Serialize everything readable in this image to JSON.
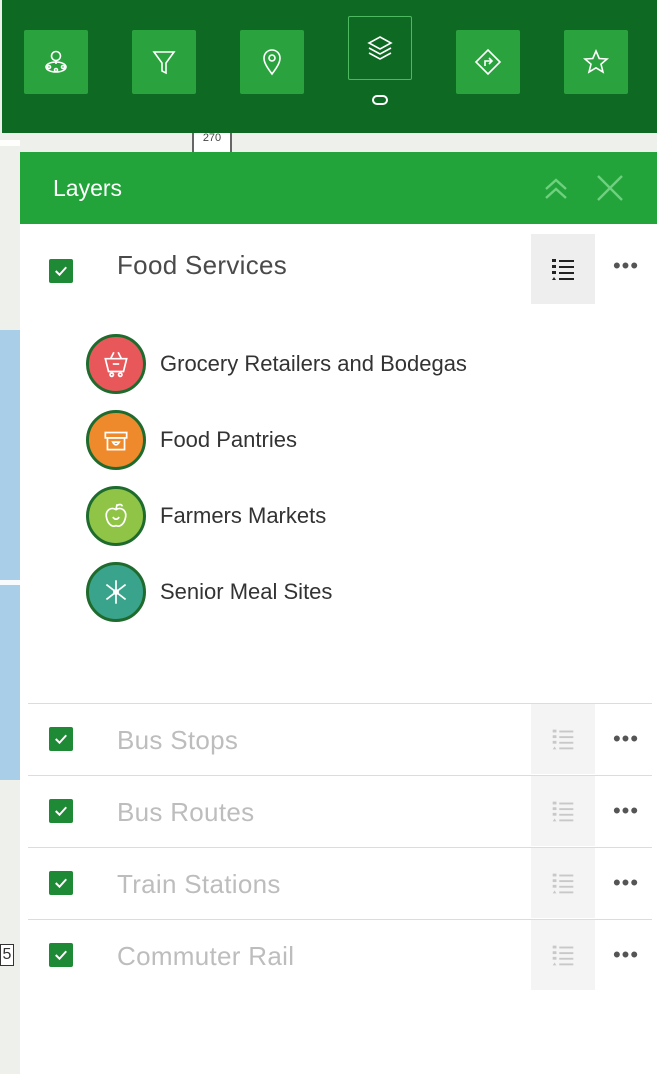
{
  "toolbar": {
    "buttons": [
      {
        "name": "map-pins-tool",
        "icon": "map-pins-icon"
      },
      {
        "name": "filter-tool",
        "icon": "filter-icon"
      },
      {
        "name": "location-tool",
        "icon": "location-pin-icon"
      },
      {
        "name": "layers-tool",
        "icon": "layers-icon",
        "active": true
      },
      {
        "name": "directions-tool",
        "icon": "directions-icon"
      },
      {
        "name": "favorites-tool",
        "icon": "star-icon"
      }
    ],
    "colors": {
      "bar": "#0e6a23",
      "button": "#2aa33e"
    }
  },
  "map": {
    "shield_text": "270",
    "edge_label": "5"
  },
  "panel": {
    "title": "Layers",
    "header_color": "#22a43a"
  },
  "layers": [
    {
      "name": "Food Services",
      "checked": true,
      "expanded": true,
      "legend": [
        {
          "label": "Grocery Retailers and Bodegas",
          "color": "#e8575a",
          "icon": "grocery-basket-icon"
        },
        {
          "label": "Food Pantries",
          "color": "#ef8a2c",
          "icon": "pantry-box-icon"
        },
        {
          "label": "Farmers Markets",
          "color": "#8fc447",
          "icon": "apple-icon"
        },
        {
          "label": "Senior Meal Sites",
          "color": "#3aa38c",
          "icon": "utensils-icon"
        }
      ]
    },
    {
      "name": "Bus Stops",
      "checked": true,
      "expanded": false
    },
    {
      "name": "Bus Routes",
      "checked": true,
      "expanded": false
    },
    {
      "name": "Train Stations",
      "checked": true,
      "expanded": false
    },
    {
      "name": "Commuter Rail",
      "checked": true,
      "expanded": false
    }
  ],
  "more_label": "•••"
}
